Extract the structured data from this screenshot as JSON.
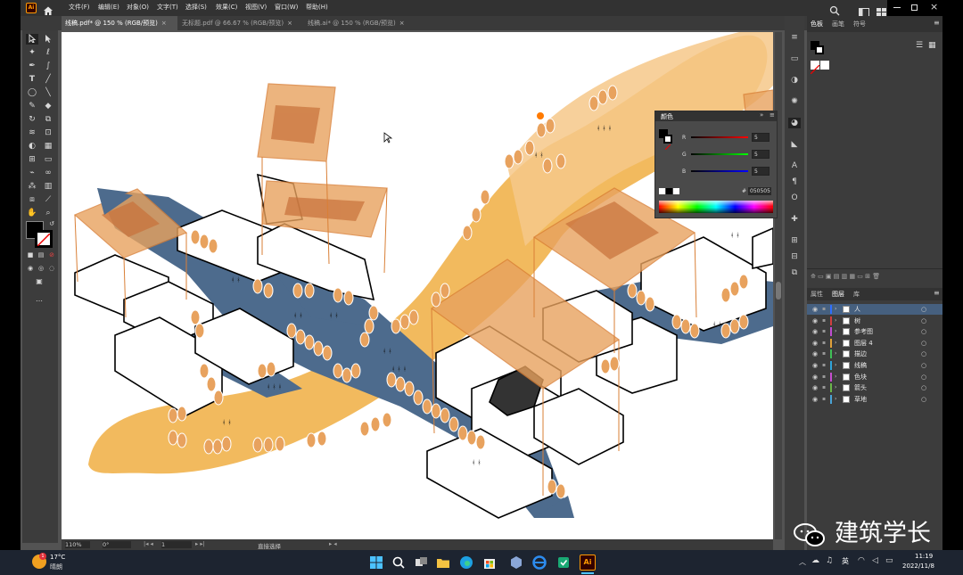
{
  "app": {
    "logo": "Ai",
    "home_icon": "home-icon"
  },
  "menu": [
    "文件(F)",
    "编辑(E)",
    "对象(O)",
    "文字(T)",
    "选择(S)",
    "效果(C)",
    "视图(V)",
    "窗口(W)",
    "帮助(H)"
  ],
  "tabs": [
    {
      "label": "线稿.pdf* @ 150 % (RGB/预览)",
      "close": "×"
    },
    {
      "label": "无标题.pdf @ 66.67 % (RGB/预览)",
      "close": "×"
    },
    {
      "label": "线稿.ai* @ 150 % (RGB/预览)",
      "close": "×"
    }
  ],
  "status": {
    "zoom": "110%",
    "angle": "0°",
    "page": "1",
    "mode": "直接选择"
  },
  "right_tabs": {
    "swatches": "色板",
    "brush": "画笔",
    "symbol": "符号"
  },
  "color_panel": {
    "title": "颜色",
    "r_label": "R",
    "r_value": "5",
    "g_label": "G",
    "g_value": "5",
    "b_label": "B",
    "b_value": "5",
    "hex_label": "#",
    "hex_value": "050505"
  },
  "layers_tabs": {
    "properties": "属性",
    "layers": "图层",
    "library": "库"
  },
  "layers": [
    {
      "name": "人",
      "color": "#2f6fff",
      "selected": true
    },
    {
      "name": "树",
      "color": "#d23f3f",
      "selected": false
    },
    {
      "name": "参考图",
      "color": "#c04dd1",
      "selected": false
    },
    {
      "name": "图层 4",
      "color": "#e0a13a",
      "selected": false
    },
    {
      "name": "描边",
      "color": "#3fbf56",
      "selected": false
    },
    {
      "name": "线稿",
      "color": "#2fa3d8",
      "selected": false
    },
    {
      "name": "色块",
      "color": "#c64ed0",
      "selected": false
    },
    {
      "name": "箭头",
      "color": "#6bb54a",
      "selected": false
    },
    {
      "name": "草地",
      "color": "#4aa3d6",
      "selected": false
    }
  ],
  "taskbar": {
    "temp": "17°C",
    "weather": "晴朗",
    "weather_badge": "1",
    "lang": "英",
    "time": "11:19",
    "date": "2022/11/8"
  },
  "watermark": "建筑学长",
  "colors": {
    "menubar": "#323232",
    "workspace": "#535353",
    "panel": "#3c3c3c",
    "orange": "#e8a25e",
    "yellow": "#f1b24c",
    "navy": "#4d6b8d",
    "selected_layer": "#46607f"
  }
}
